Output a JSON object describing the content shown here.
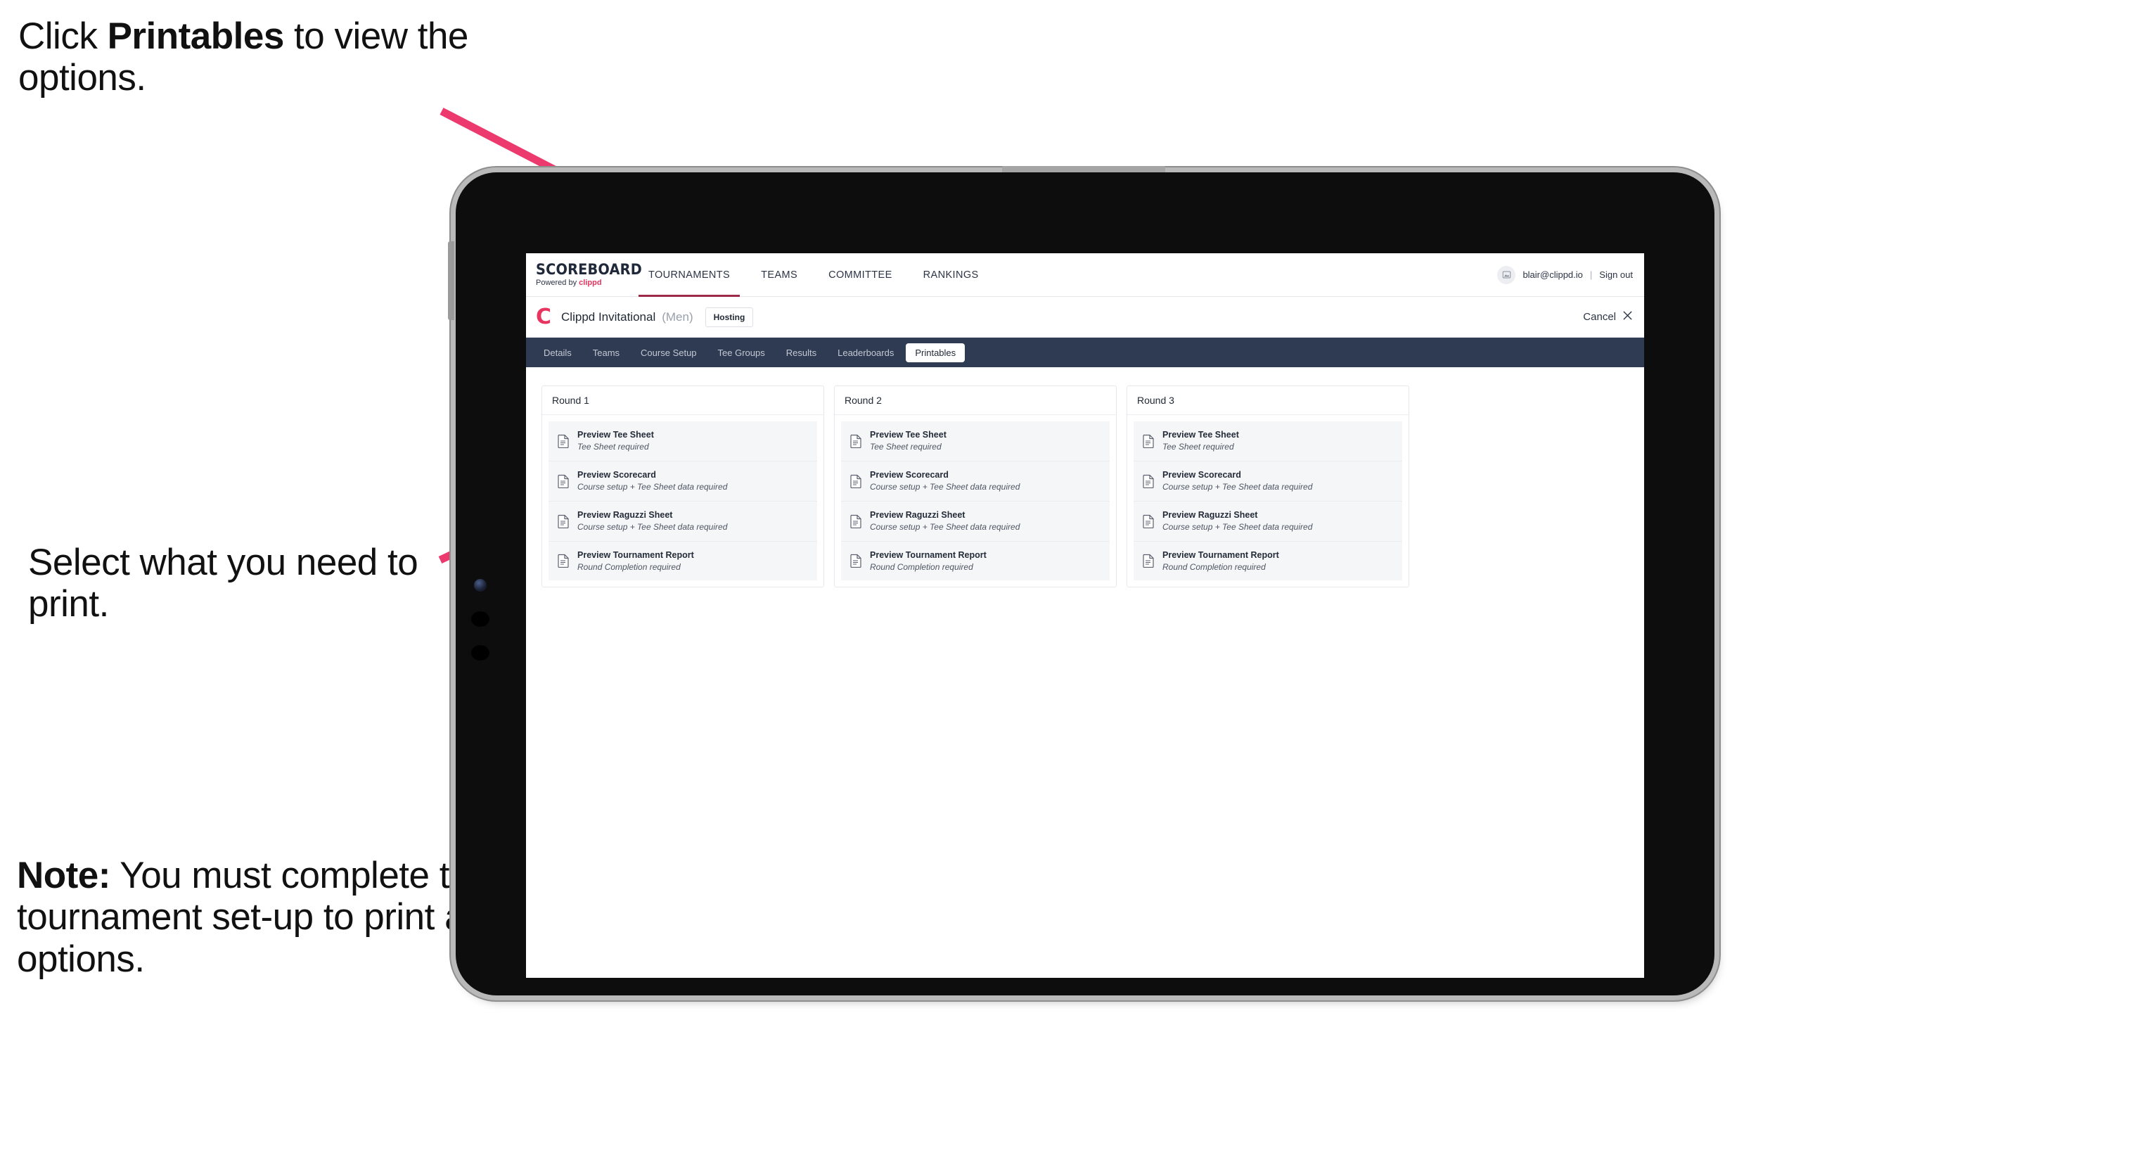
{
  "annotations": {
    "click_printables": {
      "pre": "Click ",
      "bold": "Printables",
      "post": " to view the options."
    },
    "select_print": "Select what you need to print.",
    "note": {
      "bold": "Note:",
      "text": " You must complete the tournament set-up to print all the options."
    }
  },
  "colors": {
    "accent_pink": "#ED3A6E",
    "brand_pink": "#E8355F",
    "tabbar_navy": "#2F3B52",
    "text_dark": "#222A36"
  },
  "app": {
    "topnav": {
      "brand": {
        "title": "SCOREBOARD",
        "powered_by": "Powered by ",
        "brand_name": "clippd"
      },
      "menu": [
        {
          "label": "TOURNAMENTS",
          "active": true
        },
        {
          "label": "TEAMS",
          "active": false
        },
        {
          "label": "COMMITTEE",
          "active": false
        },
        {
          "label": "RANKINGS",
          "active": false
        }
      ],
      "user": {
        "avatar_icon": "user-avatar-icon",
        "email": "blair@clippd.io",
        "separator": "|",
        "sign_out": "Sign out"
      }
    },
    "tournament_bar": {
      "logo_mark": "C",
      "name": "Clippd Invitational",
      "gender": "(Men)",
      "status_badge": "Hosting",
      "cancel_label": "Cancel",
      "cancel_icon": "close-icon"
    },
    "tabs": [
      {
        "label": "Details",
        "active": false
      },
      {
        "label": "Teams",
        "active": false
      },
      {
        "label": "Course Setup",
        "active": false
      },
      {
        "label": "Tee Groups",
        "active": false
      },
      {
        "label": "Results",
        "active": false
      },
      {
        "label": "Leaderboards",
        "active": false
      },
      {
        "label": "Printables",
        "active": true
      }
    ],
    "rounds": [
      {
        "title": "Round 1",
        "items": [
          {
            "title": "Preview Tee Sheet",
            "subtitle": "Tee Sheet required",
            "icon": "document-icon"
          },
          {
            "title": "Preview Scorecard",
            "subtitle": "Course setup + Tee Sheet data required",
            "icon": "document-icon"
          },
          {
            "title": "Preview Raguzzi Sheet",
            "subtitle": "Course setup + Tee Sheet data required",
            "icon": "document-icon"
          },
          {
            "title": "Preview Tournament Report",
            "subtitle": "Round Completion required",
            "icon": "document-icon"
          }
        ]
      },
      {
        "title": "Round 2",
        "items": [
          {
            "title": "Preview Tee Sheet",
            "subtitle": "Tee Sheet required",
            "icon": "document-icon"
          },
          {
            "title": "Preview Scorecard",
            "subtitle": "Course setup + Tee Sheet data required",
            "icon": "document-icon"
          },
          {
            "title": "Preview Raguzzi Sheet",
            "subtitle": "Course setup + Tee Sheet data required",
            "icon": "document-icon"
          },
          {
            "title": "Preview Tournament Report",
            "subtitle": "Round Completion required",
            "icon": "document-icon"
          }
        ]
      },
      {
        "title": "Round 3",
        "items": [
          {
            "title": "Preview Tee Sheet",
            "subtitle": "Tee Sheet required",
            "icon": "document-icon"
          },
          {
            "title": "Preview Scorecard",
            "subtitle": "Course setup + Tee Sheet data required",
            "icon": "document-icon"
          },
          {
            "title": "Preview Raguzzi Sheet",
            "subtitle": "Course setup + Tee Sheet data required",
            "icon": "document-icon"
          },
          {
            "title": "Preview Tournament Report",
            "subtitle": "Round Completion required",
            "icon": "document-icon"
          }
        ]
      }
    ]
  }
}
